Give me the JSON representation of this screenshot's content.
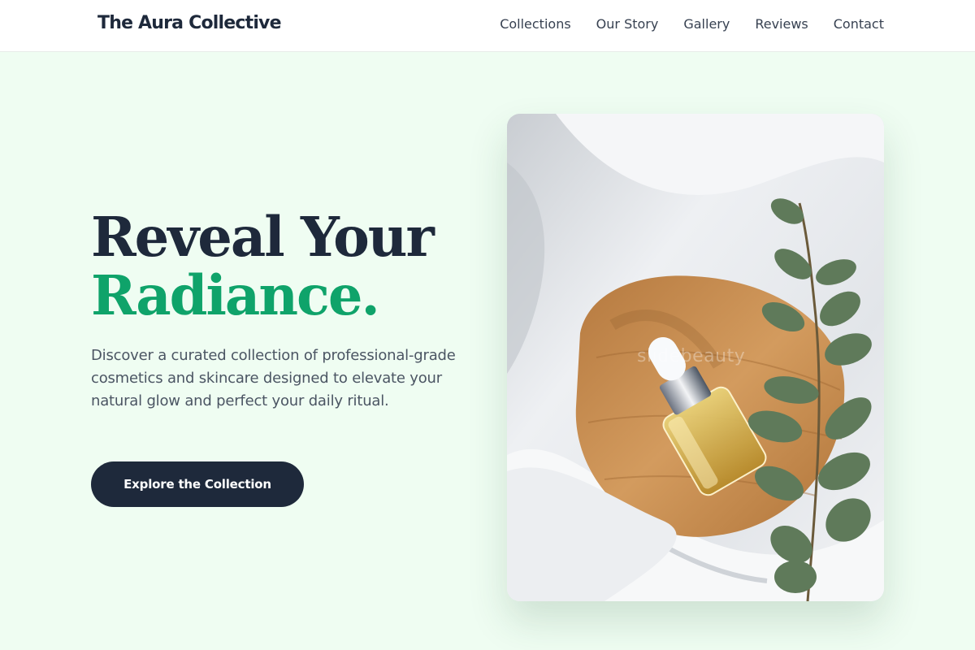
{
  "header": {
    "brand": "The Aura Collective",
    "nav": [
      {
        "label": "Collections"
      },
      {
        "label": "Our Story"
      },
      {
        "label": "Gallery"
      },
      {
        "label": "Reviews"
      },
      {
        "label": "Contact"
      }
    ]
  },
  "hero": {
    "headline_line1": "Reveal Your",
    "headline_line2": "Radiance.",
    "description": "Discover a curated collection of professional-grade cosmetics and skincare designed to elevate your natural glow and perfect your daily ritual.",
    "cta_label": "Explore the Collection",
    "image_watermark": "slidebeauty"
  },
  "colors": {
    "page_background": "#effdf2",
    "header_background": "#ffffff",
    "primary_dark": "#1e293b",
    "accent_green": "#0fa36a",
    "body_text": "#4b5563"
  }
}
